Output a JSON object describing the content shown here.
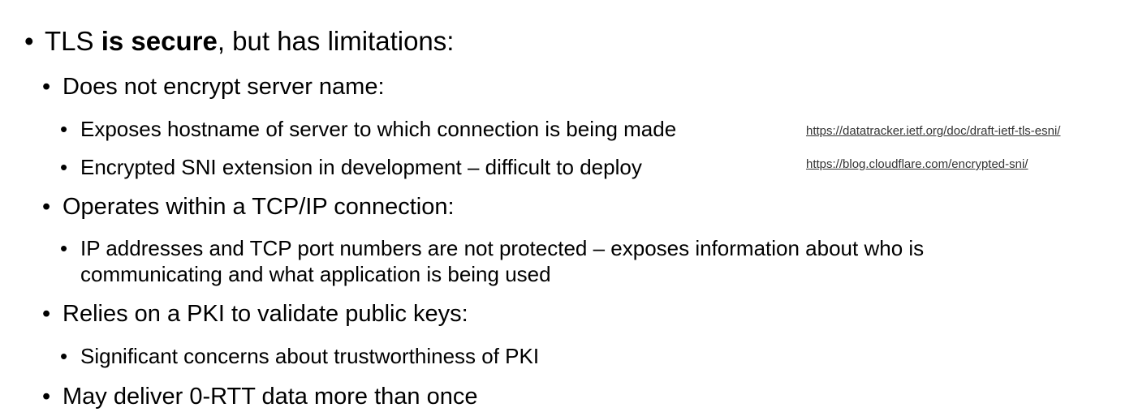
{
  "bullet_glyph": "•",
  "items": [
    {
      "level": 1,
      "pre": "TLS ",
      "bold": "is secure",
      "post": ", but has limitations:"
    },
    {
      "level": 2,
      "text": "Does not encrypt server name:"
    },
    {
      "level": 3,
      "text": "Exposes hostname of server to which connection is being made",
      "link": "https://datatracker.ietf.org/doc/draft-ietf-tls-esni/"
    },
    {
      "level": 3,
      "text": "Encrypted SNI extension in development – difficult to deploy",
      "link": "https://blog.cloudflare.com/encrypted-sni/"
    },
    {
      "level": 2,
      "text": "Operates within a TCP/IP connection:"
    },
    {
      "level": 3,
      "line1": "IP addresses and TCP port numbers are not protected – exposes information about who is",
      "line2": "communicating and what application is being used"
    },
    {
      "level": 2,
      "text": "Relies on a PKI to validate public keys:"
    },
    {
      "level": 3,
      "text": "Significant concerns about trustworthiness of PKI"
    },
    {
      "level": 2,
      "text": "May deliver 0-RTT data more than once"
    }
  ]
}
